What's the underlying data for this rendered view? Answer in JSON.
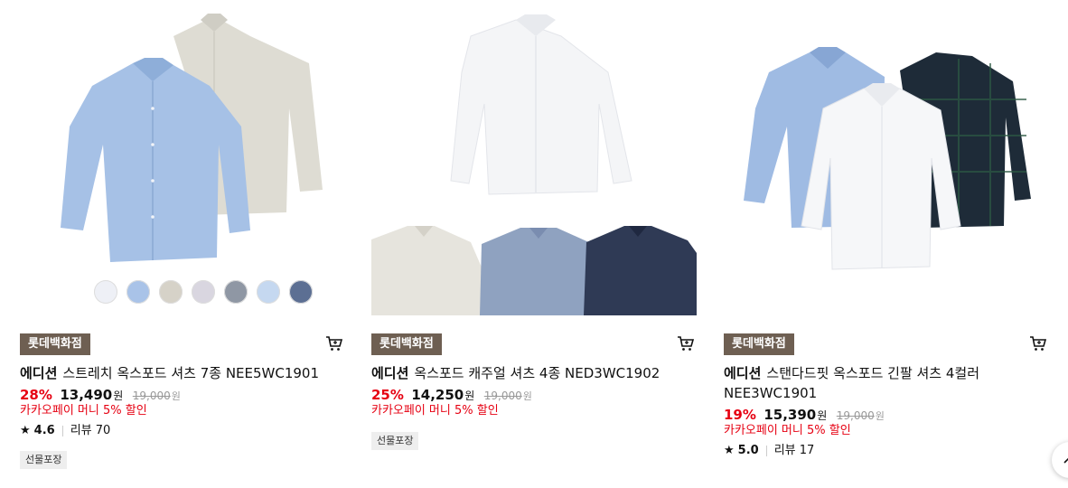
{
  "products": [
    {
      "store": "롯데백화점",
      "brand": "에디션",
      "name": "스트레치 옥스포드 셔츠 7종 NEE5WC1901",
      "discount": "28%",
      "price": "13,490",
      "won": "원",
      "old_price": "19,000",
      "old_won": "원",
      "promo": "카카오페이 머니 5% 할인",
      "rating": "4.6",
      "review": "리뷰 70",
      "gift": "선물포장"
    },
    {
      "store": "롯데백화점",
      "brand": "에디션",
      "name": "옥스포드 캐주얼 셔츠 4종 NED3WC1902",
      "discount": "25%",
      "price": "14,250",
      "won": "원",
      "old_price": "19,000",
      "old_won": "원",
      "promo": "카카오페이 머니 5% 할인",
      "gift": "선물포장"
    },
    {
      "store": "롯데백화점",
      "brand": "에디션",
      "name": "스탠다드핏 옥스포드 긴팔 셔츠 4컬러",
      "name2": "NEE3WC1901",
      "discount": "19%",
      "price": "15,390",
      "won": "원",
      "old_price": "19,000",
      "old_won": "원",
      "promo": "카카오페이 머니 5% 할인",
      "rating": "5.0",
      "review": "리뷰 17"
    }
  ],
  "swatch_colors": [
    "#eef0f6",
    "#a9c3e8",
    "#d6d2c8",
    "#d9d6e0",
    "#8f97a4",
    "#c5d8f0",
    "#5c6f93"
  ],
  "colors": {
    "accent_red": "#e60012",
    "store_badge": "#6e5f52"
  },
  "icons": {
    "cart": "cart-icon",
    "star": "star-icon",
    "top": "chevron-up-icon"
  }
}
